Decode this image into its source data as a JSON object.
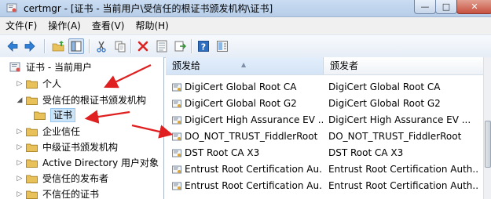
{
  "window": {
    "title": "certmgr - [证书 - 当前用户\\受信任的根证书颁发机构\\证书]",
    "controls": {
      "minimize": "—",
      "maximize": "□",
      "close": "✕"
    }
  },
  "menu": [
    "文件(F)",
    "操作(A)",
    "查看(V)",
    "帮助(H)"
  ],
  "toolbar": [
    {
      "name": "back-icon"
    },
    {
      "name": "forward-icon"
    },
    {
      "name": "up-folder-icon"
    },
    {
      "name": "show-tree-icon"
    },
    {
      "name": "cut-icon"
    },
    {
      "name": "copy-icon"
    },
    {
      "name": "delete-icon"
    },
    {
      "name": "properties-icon"
    },
    {
      "name": "export-icon"
    },
    {
      "name": "help-icon"
    },
    {
      "name": "help-topic-icon"
    }
  ],
  "tree": {
    "root": "证书 - 当前用户",
    "items": [
      {
        "label": "个人",
        "expander": "▷",
        "indent": 1
      },
      {
        "label": "受信任的根证书颁发机构",
        "expander": "◢",
        "indent": 1
      },
      {
        "label": "证书",
        "expander": "",
        "indent": 2,
        "selected": true
      },
      {
        "label": "企业信任",
        "expander": "▷",
        "indent": 1
      },
      {
        "label": "中级证书颁发机构",
        "expander": "▷",
        "indent": 1
      },
      {
        "label": "Active Directory 用户对象",
        "expander": "▷",
        "indent": 1
      },
      {
        "label": "受信任的发布者",
        "expander": "▷",
        "indent": 1
      },
      {
        "label": "不信任的证书",
        "expander": "▷",
        "indent": 1
      }
    ]
  },
  "list": {
    "columns": [
      "颁发给",
      "颁发者"
    ],
    "rows": [
      {
        "issued_to": "DigiCert Global Root CA",
        "issued_by": "DigiCert Global Root CA"
      },
      {
        "issued_to": "DigiCert Global Root G2",
        "issued_by": "DigiCert Global Root G2"
      },
      {
        "issued_to": "DigiCert High Assurance EV ...",
        "issued_by": "DigiCert High Assurance EV ..."
      },
      {
        "issued_to": "DO_NOT_TRUST_FiddlerRoot",
        "issued_by": "DO_NOT_TRUST_FiddlerRoot"
      },
      {
        "issued_to": "DST Root CA X3",
        "issued_by": "DST Root CA X3"
      },
      {
        "issued_to": "Entrust Root Certification Au...",
        "issued_by": "Entrust Root Certification Auth..."
      },
      {
        "issued_to": "Entrust Root Certification Au...",
        "issued_by": "Entrust Root Certification Auth..."
      }
    ]
  },
  "colors": {
    "annotation_arrow": "#e02020",
    "selection": "#cce4f7",
    "folder": "#e8c15a"
  }
}
